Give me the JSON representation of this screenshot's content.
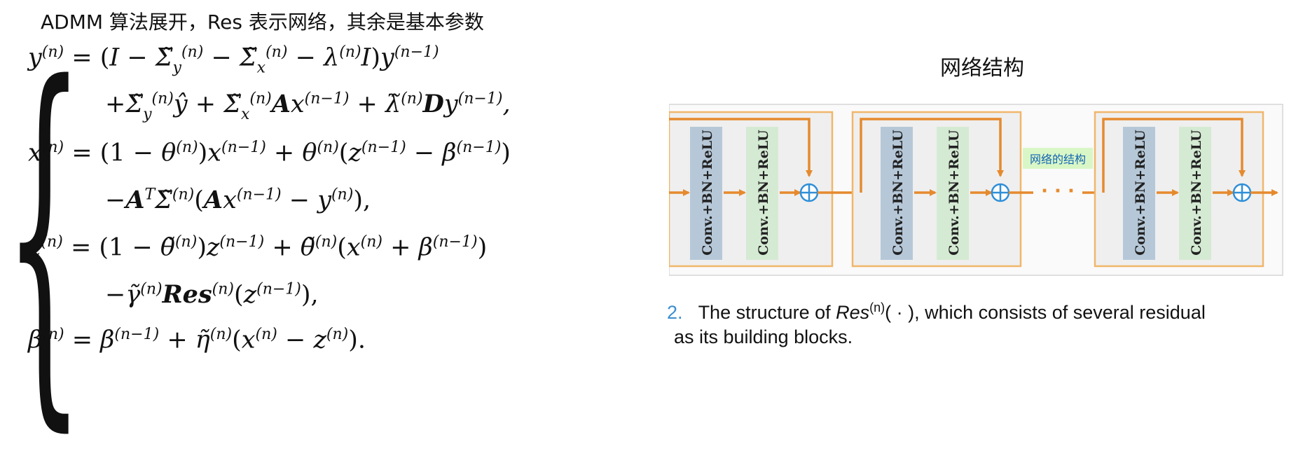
{
  "header": {
    "title": "ADMM 算法展开，Res 表示网络，其余是基本参数"
  },
  "equations": {
    "y_line1": "y⁽ⁿ⁾ = (I − Σ̃ᵧ⁽ⁿ⁾ − Σ̃ₓ⁽ⁿ⁾ − λ⁽ⁿ⁾I)y⁽ⁿ⁻¹⁾",
    "y_line2": "+Σ̃ᵧ⁽ⁿ⁾ŷ + Σ̃ₓ⁽ⁿ⁾Ax⁽ⁿ⁻¹⁾ + λ̃⁽ⁿ⁾Dy⁽ⁿ⁻¹⁾,",
    "x_line1": "x⁽ⁿ⁾ = (1 − θ⁽ⁿ⁾)x⁽ⁿ⁻¹⁾ + θ⁽ⁿ⁾(z⁽ⁿ⁻¹⁾ − β⁽ⁿ⁻¹⁾)",
    "x_line2": "−AᵀΣ̃⁽ⁿ⁾(Ax⁽ⁿ⁻¹⁾ − y⁽ⁿ⁾),",
    "z_line1": "z⁽ⁿ⁾ = (1 − θ̃⁽ⁿ⁾)z⁽ⁿ⁻¹⁾ + θ̃⁽ⁿ⁾(x⁽ⁿ⁾ + β⁽ⁿ⁻¹⁾)",
    "z_line2": "−γ̃⁽ⁿ⁾Res⁽ⁿ⁾(z⁽ⁿ⁻¹⁾),",
    "beta_line": "β⁽ⁿ⁾ = β⁽ⁿ⁻¹⁾ + η̃⁽ⁿ⁾(x⁽ⁿ⁾ − z⁽ⁿ⁾)."
  },
  "figure": {
    "title": "网络结构",
    "block_layer_label": "Conv.+BN+ReLU",
    "annotation": "网络的结构",
    "ellipsis": "· · ·",
    "colors": {
      "arrow": "#e58a2e",
      "block_border": "#f0b66a",
      "block_fill": "#efefef",
      "layer1_fill": "#b6c8d8",
      "layer2_fill": "#d5ead3",
      "plus": "#2f8fd8",
      "annotation_fill": "#d9f7c6",
      "annotation_text": "#1464b4"
    }
  },
  "caption": {
    "number": "2.",
    "text_before": "The structure of ",
    "res": "Res",
    "sup": "(n)",
    "text_after": "( · ), which consists of several residual",
    "line2": "as its building blocks."
  }
}
